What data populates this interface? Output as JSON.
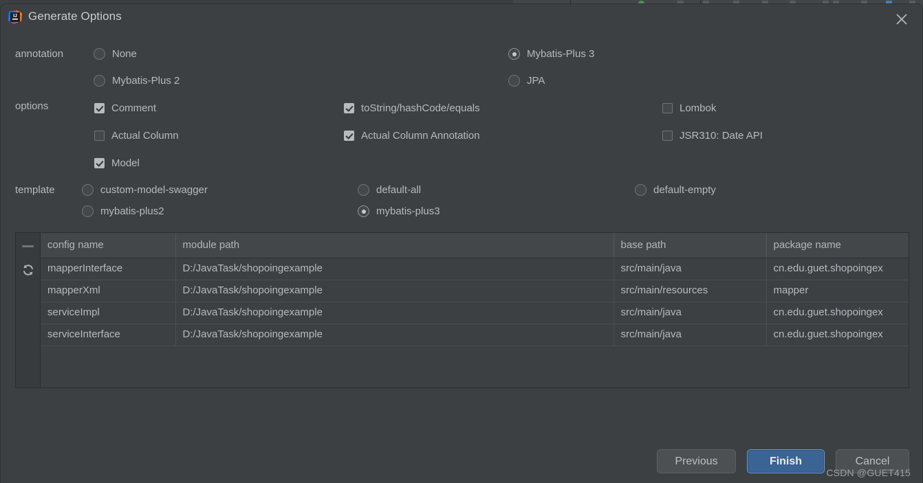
{
  "window": {
    "title": "Generate Options",
    "app_icon": "intellij-idea-icon",
    "close_icon": "close-icon"
  },
  "sections": {
    "annotation": {
      "label": "annotation",
      "options": [
        {
          "label": "None",
          "selected": false
        },
        {
          "label": "Mybatis-Plus 3",
          "selected": true
        },
        {
          "label": "Mybatis-Plus 2",
          "selected": false
        },
        {
          "label": "JPA",
          "selected": false
        }
      ]
    },
    "options": {
      "label": "options",
      "items": [
        {
          "label": "Comment",
          "checked": true
        },
        {
          "label": "toString/hashCode/equals",
          "checked": true
        },
        {
          "label": "Lombok",
          "checked": false
        },
        {
          "label": "Actual Column",
          "checked": false
        },
        {
          "label": "Actual Column Annotation",
          "checked": true
        },
        {
          "label": "JSR310: Date API",
          "checked": false
        },
        {
          "label": "Model",
          "checked": true
        }
      ]
    },
    "template": {
      "label": "template",
      "options": [
        {
          "label": "custom-model-swagger",
          "selected": false
        },
        {
          "label": "default-all",
          "selected": false
        },
        {
          "label": "default-empty",
          "selected": false
        },
        {
          "label": "mybatis-plus2",
          "selected": false
        },
        {
          "label": "mybatis-plus3",
          "selected": true
        }
      ]
    }
  },
  "table": {
    "remove_icon": "minus-icon",
    "refresh_icon": "refresh-icon",
    "columns": [
      "config name",
      "module path",
      "base path",
      "package name"
    ],
    "rows": [
      {
        "config_name": "mapperInterface",
        "module_path": "D:/JavaTask/shopoingexample",
        "base_path": "src/main/java",
        "package_name": "cn.edu.guet.shopoingex"
      },
      {
        "config_name": "mapperXml",
        "module_path": "D:/JavaTask/shopoingexample",
        "base_path": "src/main/resources",
        "package_name": "mapper"
      },
      {
        "config_name": "serviceImpl",
        "module_path": "D:/JavaTask/shopoingexample",
        "base_path": "src/main/java",
        "package_name": "cn.edu.guet.shopoingex"
      },
      {
        "config_name": "serviceInterface",
        "module_path": "D:/JavaTask/shopoingexample",
        "base_path": "src/main/java",
        "package_name": "cn.edu.guet.shopoingex"
      }
    ]
  },
  "footer": {
    "previous_label": "Previous",
    "finish_label": "Finish",
    "cancel_label": "Cancel",
    "primary_color": "#3b6394"
  },
  "watermark": "CSDN @GUET415"
}
